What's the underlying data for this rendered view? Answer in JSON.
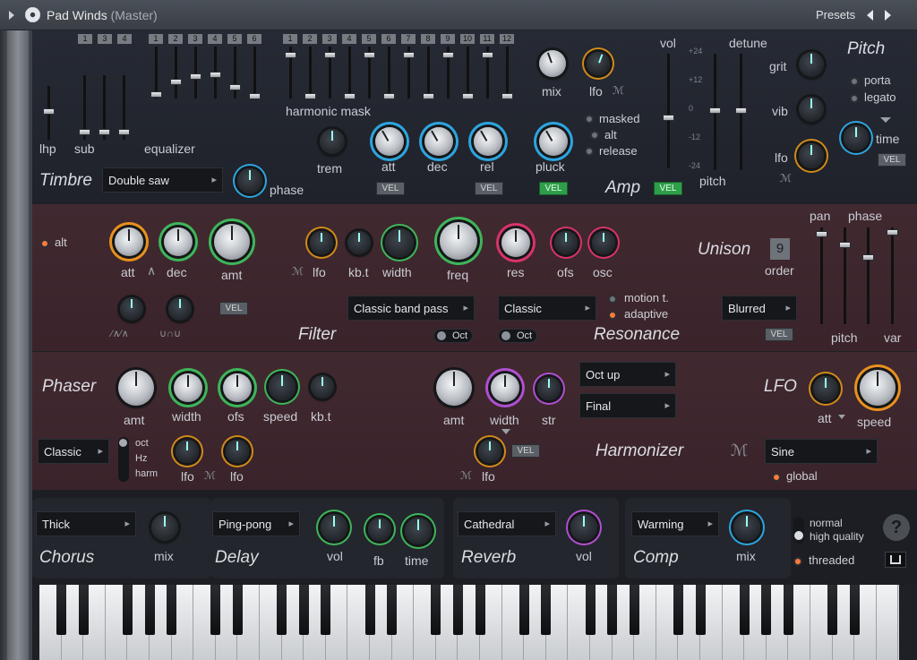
{
  "window": {
    "title": "Pad Winds",
    "subtitle": "(Master)",
    "presets_label": "Presets",
    "prev_icon": "caret-left-icon",
    "next_icon": "caret-right-icon"
  },
  "timbre": {
    "section": "Timbre",
    "lhp": "lhp",
    "sub": "sub",
    "equalizer": "equalizer",
    "harmonic_mask": "harmonic mask",
    "wave": "Double saw",
    "phase": "phase",
    "sub_nums": [
      "1",
      "3",
      "4"
    ],
    "eq_nums": [
      "1",
      "2",
      "3",
      "4",
      "5",
      "6"
    ],
    "harm_nums": [
      "1",
      "2",
      "3",
      "4",
      "5",
      "6",
      "7",
      "8",
      "9",
      "10",
      "11",
      "12"
    ]
  },
  "amp": {
    "section": "Amp",
    "mix": "mix",
    "lfo": "lfo",
    "trem": "trem",
    "att": "att",
    "dec": "dec",
    "rel": "rel",
    "pluck": "pluck",
    "vol": "vol",
    "vel": "VEL",
    "options": [
      "masked",
      "alt",
      "release"
    ]
  },
  "pitch": {
    "section": "Pitch",
    "detune": "detune",
    "pitch": "pitch",
    "grit": "grit",
    "vib": "vib",
    "lfo": "lfo",
    "porta": "porta",
    "legato": "legato",
    "time": "time",
    "vel": "VEL",
    "scale": [
      "+24",
      "+12",
      "0",
      "-12",
      "-24"
    ]
  },
  "filter": {
    "section": "Filter",
    "alt": "alt",
    "att": "att",
    "dec": "dec",
    "amt": "amt",
    "lfo": "lfo",
    "kbt": "kb.t",
    "width": "width",
    "freq": "freq",
    "res": "res",
    "type": "Classic band pass",
    "oct": "Oct",
    "vel": "VEL"
  },
  "resonance": {
    "section": "Resonance",
    "ofs": "ofs",
    "osc": "osc",
    "type": "Classic",
    "oct": "Oct",
    "motion": "motion t.",
    "adaptive": "adaptive"
  },
  "unison": {
    "section": "Unison",
    "order": "order",
    "order_value": "9",
    "mode": "Blurred",
    "vel": "VEL",
    "pan": "pan",
    "phase": "phase",
    "pitch": "pitch",
    "var": "var"
  },
  "phaser": {
    "section": "Phaser",
    "amt": "amt",
    "width": "width",
    "ofs": "ofs",
    "speed": "speed",
    "kbt": "kb.t",
    "mode": "Classic",
    "options": [
      "oct",
      "Hz",
      "harm"
    ],
    "lfo1": "lfo",
    "lfo2": "lfo"
  },
  "harmonizer": {
    "section": "Harmonizer",
    "amt": "amt",
    "width": "width",
    "str": "str",
    "lfo": "lfo",
    "vel": "VEL",
    "mode1": "Oct up",
    "mode2": "Final"
  },
  "lfo": {
    "section": "LFO",
    "att": "att",
    "speed": "speed",
    "shape": "Sine",
    "global": "global"
  },
  "fx": {
    "chorus": {
      "section": "Chorus",
      "type": "Thick",
      "mix": "mix"
    },
    "delay": {
      "section": "Delay",
      "type": "Ping-pong",
      "vol": "vol",
      "fb": "fb",
      "time": "time"
    },
    "reverb": {
      "section": "Reverb",
      "type": "Cathedral",
      "vol": "vol"
    },
    "comp": {
      "section": "Comp",
      "type": "Warming",
      "mix": "mix"
    },
    "quality": [
      "normal",
      "high quality"
    ],
    "threaded": "threaded",
    "help": "?"
  }
}
